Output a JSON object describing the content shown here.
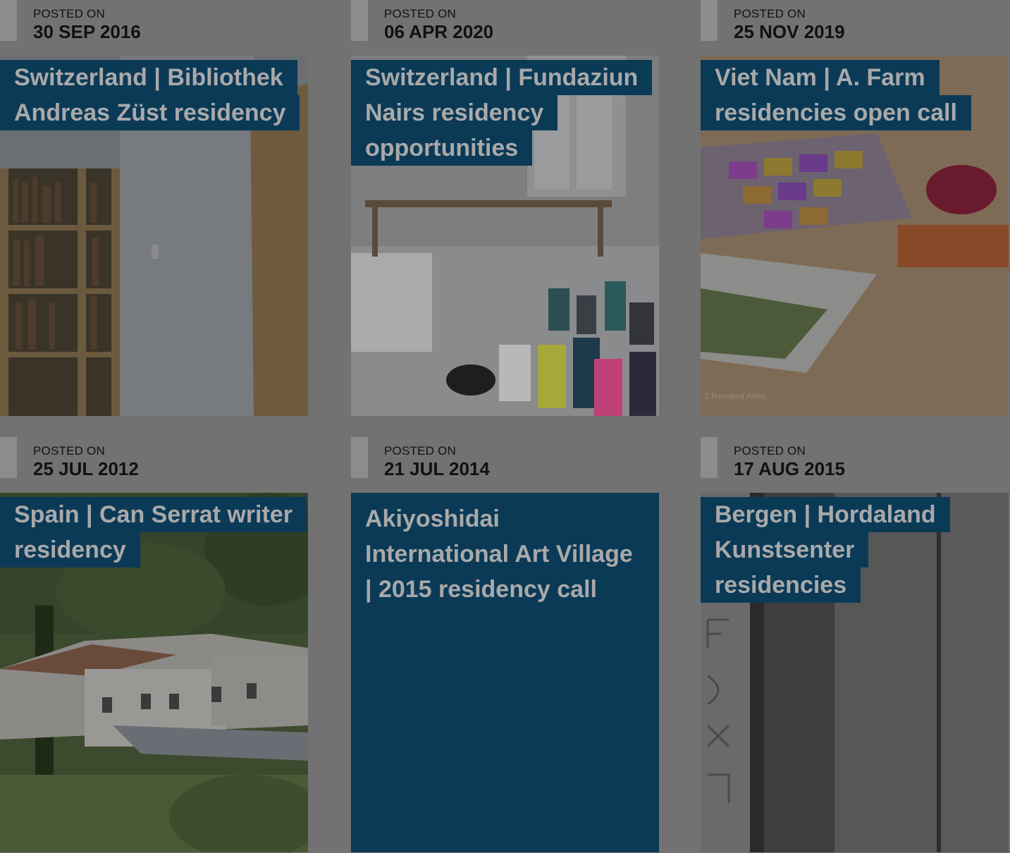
{
  "posts": [
    {
      "posted_label": "POSTED ON",
      "date": "30 SEP 2016",
      "title": "Switzerland | Bibliothek Andreas Züst residency",
      "image": "library-bookshelves"
    },
    {
      "posted_label": "POSTED ON",
      "date": "06 APR 2020",
      "title": "Switzerland | Fundaziun Nairs residency opportunities",
      "image": "studio-paint-bottles"
    },
    {
      "posted_label": "POSTED ON",
      "date": "25 NOV 2019",
      "title": "Viet Nam | A. Farm residencies open call",
      "image": "table-artworks",
      "image_caption": "2 Resident Artist"
    },
    {
      "posted_label": "POSTED ON",
      "date": "25 JUL 2012",
      "title": "Spain | Can Serrat writer residency",
      "image": "white-farmhouse"
    },
    {
      "posted_label": "POSTED ON",
      "date": "21 JUL 2014",
      "title": "Akiyoshidai International Art Village | 2015 residency call",
      "image": "none"
    },
    {
      "posted_label": "POSTED ON",
      "date": "17 AUG 2015",
      "title": "Bergen | Hordaland Kunstsenter residencies",
      "image": "grey-doorway"
    }
  ],
  "colors": {
    "overlay_bg": "#727272",
    "title_bg": "#0b3a57",
    "title_text": "#a9a9a9"
  }
}
